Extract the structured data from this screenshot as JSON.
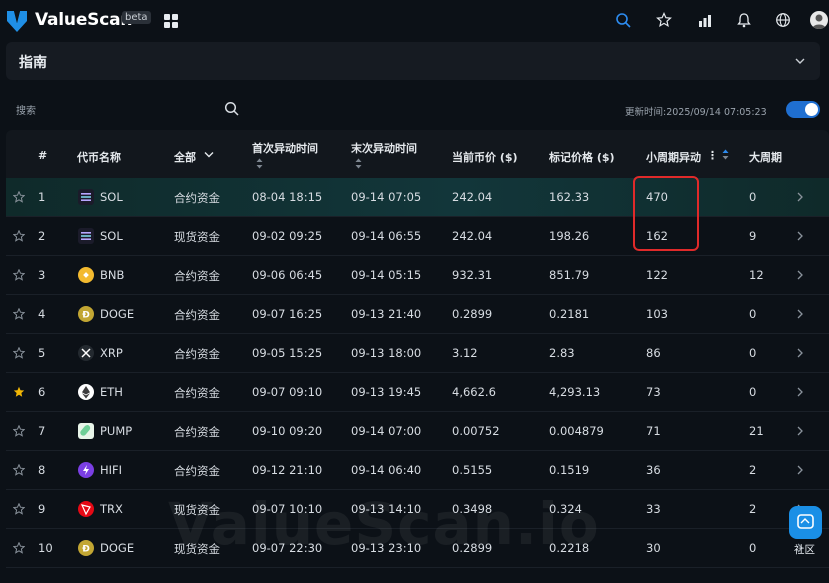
{
  "app": {
    "name": "ValueScan",
    "badge": "beta"
  },
  "guide": {
    "title": "指南"
  },
  "search": {
    "placeholder": "搜索"
  },
  "updated": "更新时间:2025/09/14 07:05:23",
  "table": {
    "headers": {
      "rank": "#",
      "coin": "代币名称",
      "filter": "全部",
      "first_time": "首次异动时间",
      "last_time": "末次异动时间",
      "price": "当前币价 ($)",
      "mark_price": "标记价格 ($)",
      "small_cycle": "小周期异动",
      "large_cycle": "大周期"
    },
    "rows": [
      {
        "rank": "1",
        "coin": "SOL",
        "type": "合约资金",
        "first": "08-04 18:15",
        "last": "09-14 07:05",
        "price": "242.04",
        "mark": "162.33",
        "small": "470",
        "large": "0",
        "starred": false,
        "icon": "sol-icon",
        "color": "#1b1b2a"
      },
      {
        "rank": "2",
        "coin": "SOL",
        "type": "现货资金",
        "first": "09-02 09:25",
        "last": "09-14 06:55",
        "price": "242.04",
        "mark": "198.26",
        "small": "162",
        "large": "9",
        "starred": false,
        "icon": "sol-icon",
        "color": "#1b1b2a"
      },
      {
        "rank": "3",
        "coin": "BNB",
        "type": "合约资金",
        "first": "09-06 06:45",
        "last": "09-14 05:15",
        "price": "932.31",
        "mark": "851.79",
        "small": "122",
        "large": "12",
        "starred": false,
        "icon": "bnb-icon",
        "color": "#f3ba2f"
      },
      {
        "rank": "4",
        "coin": "DOGE",
        "type": "合约资金",
        "first": "09-07 16:25",
        "last": "09-13 21:40",
        "price": "0.2899",
        "mark": "0.2181",
        "small": "103",
        "large": "0",
        "starred": false,
        "icon": "doge-icon",
        "color": "#c2a633"
      },
      {
        "rank": "5",
        "coin": "XRP",
        "type": "合约资金",
        "first": "09-05 15:25",
        "last": "09-13 18:00",
        "price": "3.12",
        "mark": "2.83",
        "small": "86",
        "large": "0",
        "starred": false,
        "icon": "xrp-icon",
        "color": "#23292f"
      },
      {
        "rank": "6",
        "coin": "ETH",
        "type": "合约资金",
        "first": "09-07 09:10",
        "last": "09-13 19:45",
        "price": "4,662.6",
        "mark": "4,293.13",
        "small": "73",
        "large": "0",
        "starred": true,
        "icon": "eth-icon",
        "color": "#ffffff"
      },
      {
        "rank": "7",
        "coin": "PUMP",
        "type": "合约资金",
        "first": "09-10 09:20",
        "last": "09-14 07:00",
        "price": "0.00752",
        "mark": "0.004879",
        "small": "71",
        "large": "21",
        "starred": false,
        "icon": "pump-icon",
        "color": "#6fcf97"
      },
      {
        "rank": "8",
        "coin": "HIFI",
        "type": "合约资金",
        "first": "09-12 21:10",
        "last": "09-14 06:40",
        "price": "0.5155",
        "mark": "0.1519",
        "small": "36",
        "large": "2",
        "starred": false,
        "icon": "hifi-icon",
        "color": "#7b3fe4"
      },
      {
        "rank": "9",
        "coin": "TRX",
        "type": "现货资金",
        "first": "09-07 10:10",
        "last": "09-13 14:10",
        "price": "0.3498",
        "mark": "0.324",
        "small": "33",
        "large": "2",
        "starred": false,
        "icon": "trx-icon",
        "color": "#e50915"
      },
      {
        "rank": "10",
        "coin": "DOGE",
        "type": "现货资金",
        "first": "09-07 22:30",
        "last": "09-13 23:10",
        "price": "0.2899",
        "mark": "0.2218",
        "small": "30",
        "large": "0",
        "starred": false,
        "icon": "doge-icon",
        "color": "#c2a633"
      }
    ]
  },
  "watermark": "ValueScan.io",
  "community": "社区",
  "colors": {
    "accent": "#1f6fd1",
    "highlight": "#e02a2a",
    "star": "#f2b705"
  }
}
